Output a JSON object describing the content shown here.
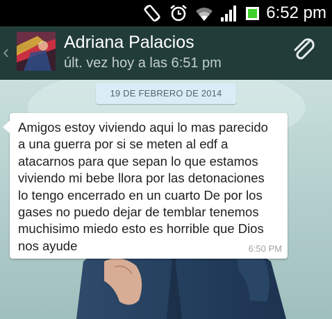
{
  "status_bar": {
    "time": "6:52 pm",
    "icons": [
      "screen-rotation-icon",
      "alarm-clock-icon",
      "wifi-icon",
      "signal-bars-icon",
      "battery-icon"
    ]
  },
  "header": {
    "contact_name": "Adriana Palacios",
    "last_seen": "últ. vez hoy a las 6:51 pm",
    "back_icon": "chevron-left-icon",
    "attach_icon": "paperclip-icon",
    "background_color": "#223c39"
  },
  "conversation": {
    "date_separator": "19 DE FEBRERO DE 2014",
    "messages": [
      {
        "direction": "incoming",
        "text": "Amigos estoy viviendo aqui lo mas parecido\na una guerra por si se meten al edf a\natacarnos para que sepan lo que estamos\nviviendo mi bebe llora por las detonaciones\nlo tengo encerrado en un cuarto De por los\ngases no puedo dejar de temblar tenemos\nmuchisimo miedo esto es horrible que Dios\nnos ayude",
        "time": "6:50 PM"
      }
    ]
  }
}
